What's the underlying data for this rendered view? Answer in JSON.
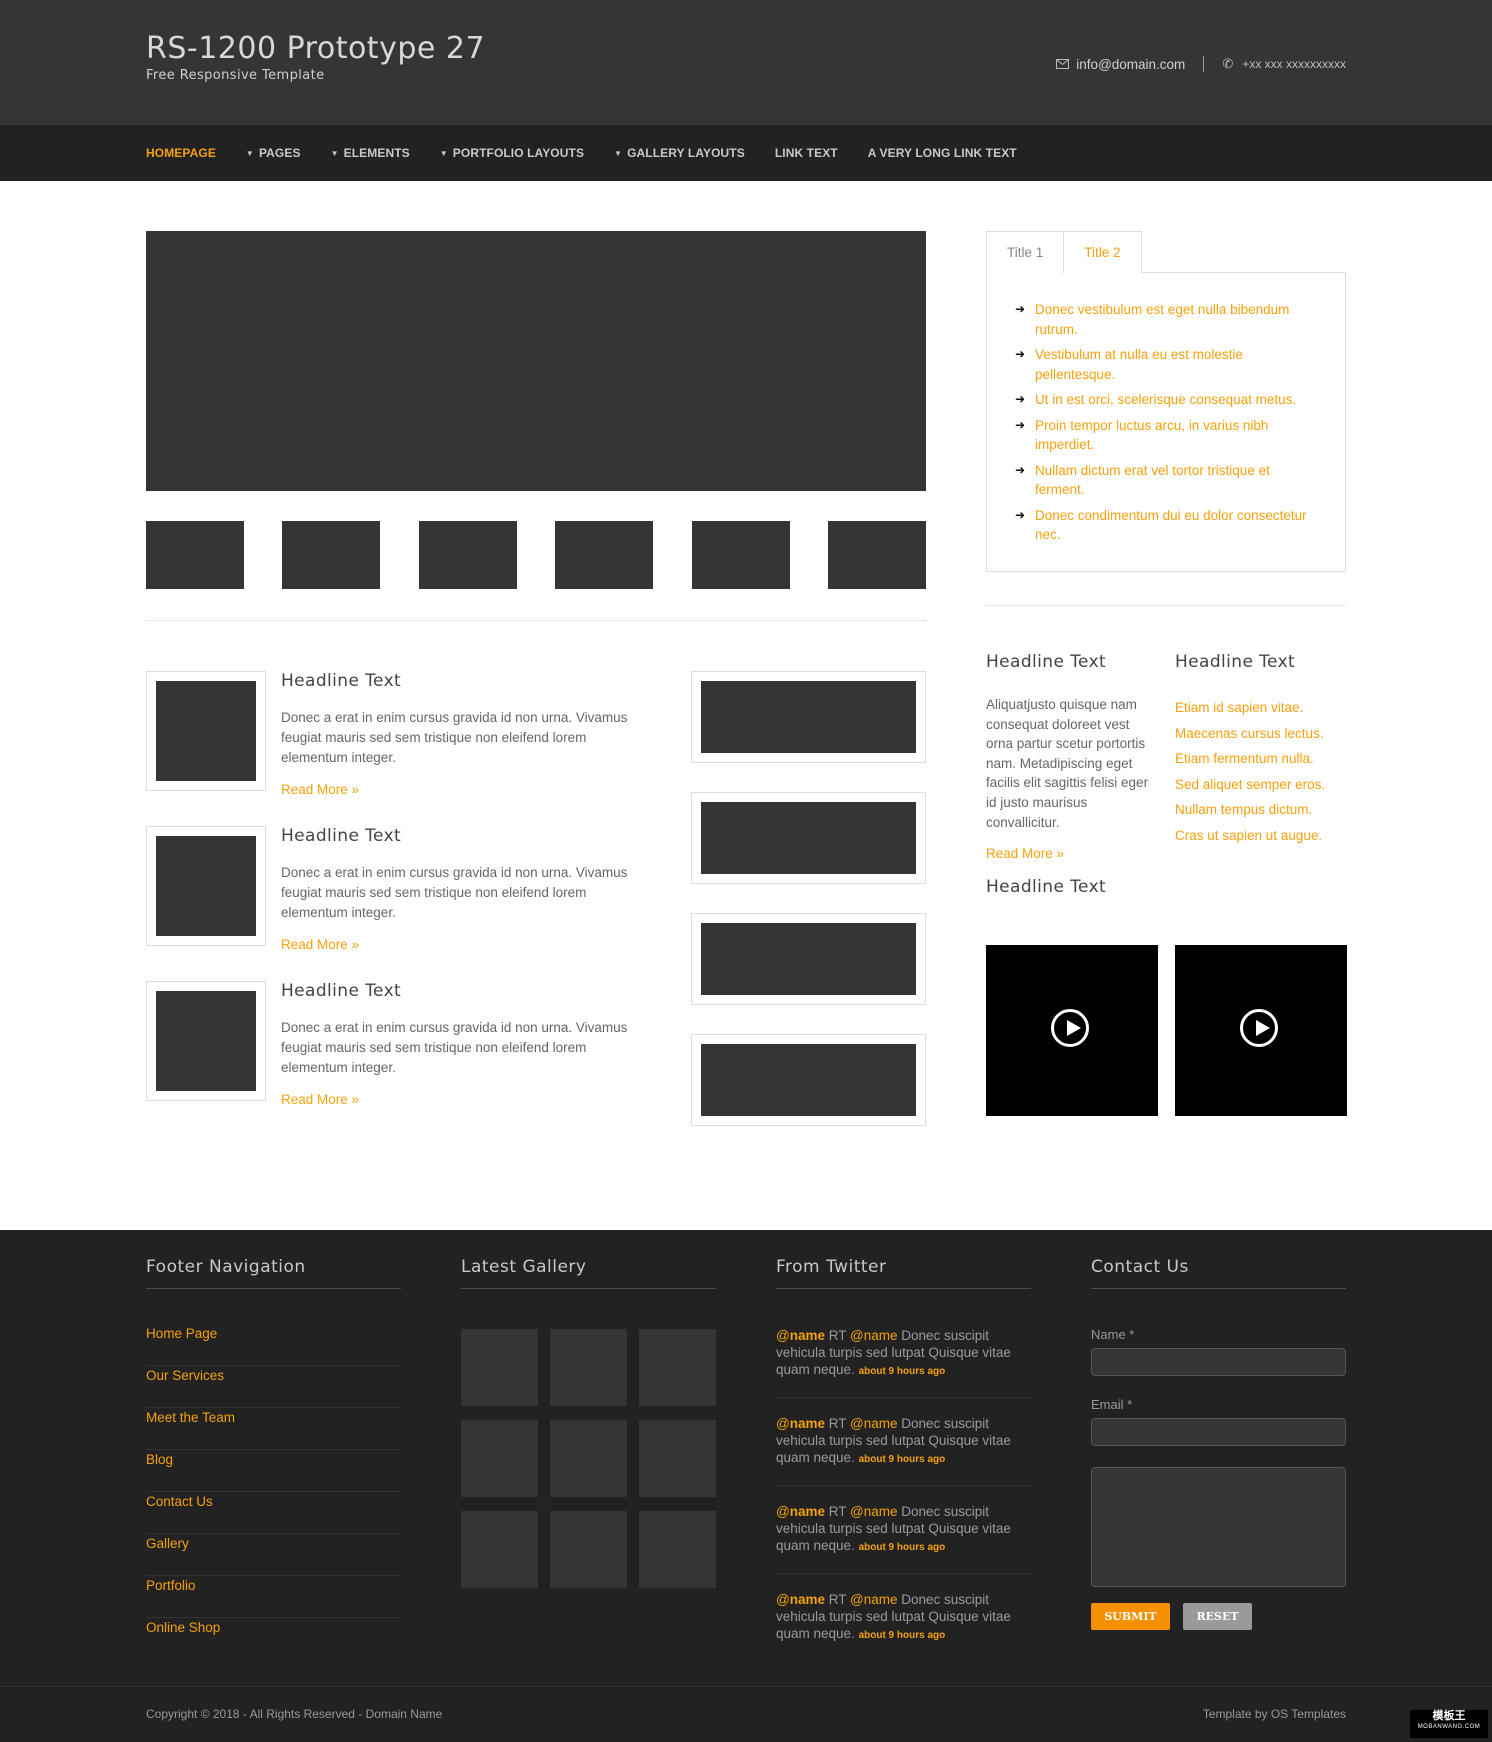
{
  "header": {
    "title": "RS-1200 Prototype 27",
    "tagline": "Free Responsive Template",
    "email": "info@domain.com",
    "phone": "+xx xxx xxxxxxxxxx",
    "email_icon": "envelope-icon",
    "phone_icon": "phone-icon"
  },
  "nav": {
    "items": [
      {
        "label": "HOMEPAGE",
        "dropdown": false,
        "active": true
      },
      {
        "label": "PAGES",
        "dropdown": true
      },
      {
        "label": "ELEMENTS",
        "dropdown": true
      },
      {
        "label": "PORTFOLIO LAYOUTS",
        "dropdown": true
      },
      {
        "label": "GALLERY LAYOUTS",
        "dropdown": true
      },
      {
        "label": "LINK TEXT",
        "dropdown": false
      },
      {
        "label": "A VERY LONG LINK TEXT",
        "dropdown": false
      }
    ]
  },
  "articles": [
    {
      "headline": "Headline Text",
      "body": "Donec a erat in enim cursus gravida id non urna. Vivamus feugiat mauris sed sem tristique non eleifend lorem elementum integer.",
      "read_more": "Read More »"
    },
    {
      "headline": "Headline Text",
      "body": "Donec a erat in enim cursus gravida id non urna. Vivamus feugiat mauris sed sem tristique non eleifend lorem elementum integer.",
      "read_more": "Read More »"
    },
    {
      "headline": "Headline Text",
      "body": "Donec a erat in enim cursus gravida id non urna. Vivamus feugiat mauris sed sem tristique non eleifend lorem elementum integer.",
      "read_more": "Read More »"
    }
  ],
  "tabs": {
    "tab1": "Title 1",
    "tab2": "Title 2",
    "items": [
      "Donec vestibulum est eget nulla bibendum rutrum.",
      "Vestibulum at nulla eu est molestie pellentesque.",
      "Ut in est orci, scelerisque consequat metus.",
      "Proin tempor luctus arcu, in varius nibh imperdiet.",
      "Nullam dictum erat vel tortor tristique et ferment.",
      "Donec condimentum dui eu dolor consectetur nec."
    ]
  },
  "right": {
    "col1": {
      "headline": "Headline Text",
      "body": "Aliquatjusto quisque nam consequat doloreet vest orna partur scetur portortis nam. Metadipiscing eget facilis elit sagittis felisi eger id justo maurisus convallicitur.",
      "read_more": "Read More »"
    },
    "col2": {
      "headline": "Headline Text",
      "links": [
        "Etiam id sapien vitae.",
        "Maecenas cursus lectus.",
        "Etiam fermentum nulla.",
        "Sed aliquet semper eros.",
        "Nullam tempus dictum.",
        "Cras ut sapien ut augue."
      ]
    },
    "video_headline": "Headline Text"
  },
  "footer": {
    "nav_title": "Footer Navigation",
    "nav_items": [
      "Home Page",
      "Our Services",
      "Meet the Team",
      "Blog",
      "Contact Us",
      "Gallery",
      "Portfolio",
      "Online Shop"
    ],
    "gallery_title": "Latest Gallery",
    "twitter_title": "From Twitter",
    "tweets": [
      {
        "at1": "@",
        "name1": "name",
        "rt": " RT ",
        "at2": "@",
        "name2": "name",
        "text": " Donec suscipit vehicula turpis sed lutpat Quisque vitae quam neque. ",
        "time": "about 9 hours ago"
      },
      {
        "at1": "@",
        "name1": "name",
        "rt": " RT ",
        "at2": "@",
        "name2": "name",
        "text": " Donec suscipit vehicula turpis sed lutpat Quisque vitae quam neque. ",
        "time": "about 9 hours ago"
      },
      {
        "at1": "@",
        "name1": "name",
        "rt": " RT ",
        "at2": "@",
        "name2": "name",
        "text": " Donec suscipit vehicula turpis sed lutpat Quisque vitae quam neque. ",
        "time": "about 9 hours ago"
      },
      {
        "at1": "@",
        "name1": "name",
        "rt": " RT ",
        "at2": "@",
        "name2": "name",
        "text": " Donec suscipit vehicula turpis sed lutpat Quisque vitae quam neque. ",
        "time": "about 9 hours ago"
      }
    ],
    "contact_title": "Contact Us",
    "name_label": "Name *",
    "email_label": "Email *",
    "submit": "SUBMIT",
    "reset": "RESET"
  },
  "copyright": {
    "left": "Copyright © 2018 - All Rights Reserved - Domain Name",
    "right": "Template by OS Templates"
  },
  "badge": {
    "title": "模板王",
    "sub": "MOBANWANG.COM"
  },
  "colors": {
    "accent": "#f5a10e",
    "dark": "#222222",
    "panel": "#353535"
  }
}
